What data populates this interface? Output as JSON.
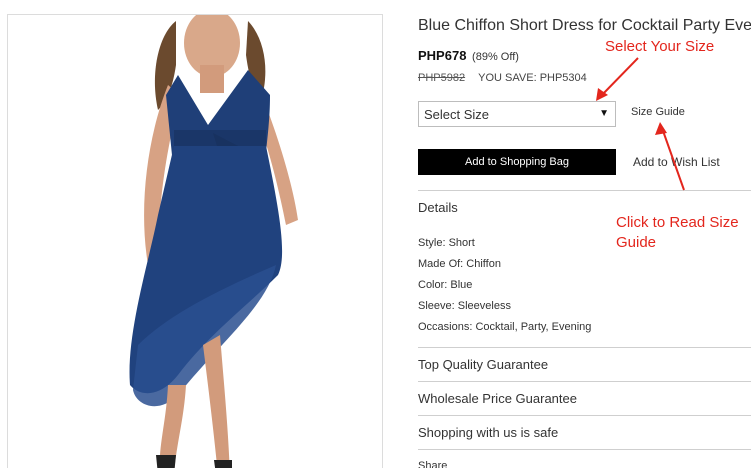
{
  "product": {
    "title": "Blue Chiffon Short Dress for Cocktail Party Evening",
    "price": "PHP678",
    "discount": "(89% Off)",
    "old_price": "PHP5982",
    "you_save": "YOU SAVE: PHP5304"
  },
  "size": {
    "select_label": "Select Size",
    "guide_label": "Size Guide"
  },
  "actions": {
    "add_to_bag": "Add to Shopping Bag",
    "add_to_wishlist": "Add to Wish List"
  },
  "details": {
    "heading": "Details",
    "specs": [
      "Style: Short",
      "Made Of: Chiffon",
      "Color: Blue",
      "Sleeve: Sleeveless",
      "Occasions: Cocktail, Party, Evening"
    ]
  },
  "accordion": [
    "Top Quality Guarantee",
    "Wholesale Price Guarantee",
    "Shopping with us is safe"
  ],
  "share": {
    "label": "Share"
  },
  "annotations": {
    "select_size": "Select Your Size",
    "read_guide_line1": "Click to Read Size",
    "read_guide_line2": "Guide",
    "color": "#e3261d"
  },
  "colors": {
    "dress": "#1f3f78",
    "button": "#000000"
  }
}
